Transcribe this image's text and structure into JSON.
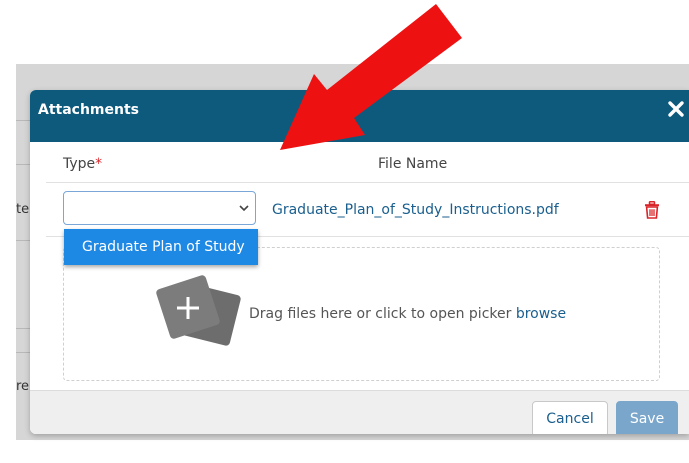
{
  "background": {
    "fragments": [
      "te",
      "re ("
    ]
  },
  "modal": {
    "title": "Attachments",
    "columns": {
      "type_label": "Type",
      "required_mark": "*",
      "file_name_label": "File Name"
    },
    "row": {
      "type_value": "",
      "dropdown_option": "Graduate Plan of Study",
      "file_name": "Graduate_Plan_of_Study_Instructions.pdf"
    },
    "dropzone": {
      "text": "Drag files here or click to open picker ",
      "browse_label": "browse"
    },
    "footer": {
      "cancel_label": "Cancel",
      "save_label": "Save"
    }
  },
  "colors": {
    "header_bg": "#0d5a7d",
    "option_highlight": "#1e88e5",
    "link": "#1a5f8e",
    "required": "#d9252a",
    "delete": "#d9252a",
    "save_bg": "#7aa6cc",
    "annotation_arrow": "#ee1111"
  },
  "icons": {
    "close": "close-x-icon",
    "chevron": "chevron-down-icon",
    "delete": "trash-icon",
    "upload": "add-files-icon",
    "annotation": "red-arrow-annotation"
  }
}
